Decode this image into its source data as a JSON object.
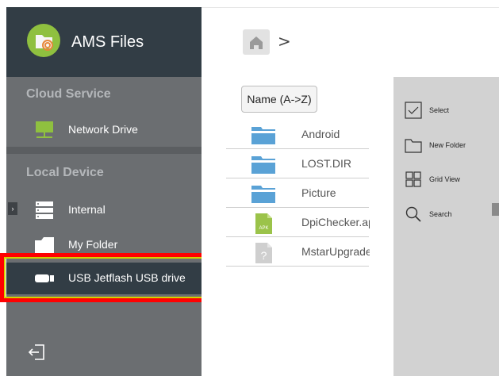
{
  "app": {
    "title": "AMS Files"
  },
  "sidebar": {
    "cloud_section": "Cloud Service",
    "cloud_items": [
      {
        "label": "Network Drive",
        "icon": "network-drive-icon"
      }
    ],
    "local_section": "Local Device",
    "local_items": [
      {
        "label": "Internal",
        "icon": "storage-icon"
      },
      {
        "label": "My Folder",
        "icon": "folder-icon"
      },
      {
        "label": "USB Jetflash USB drive",
        "icon": "usb-icon",
        "selected": true
      }
    ],
    "expander_glyph": "›"
  },
  "breadcrumb": {
    "separator": ">"
  },
  "sort": {
    "label": "Name (A->Z)"
  },
  "files": [
    {
      "name": "Android",
      "type": "folder"
    },
    {
      "name": "LOST.DIR",
      "type": "folder"
    },
    {
      "name": "Picture",
      "type": "folder"
    },
    {
      "name": "DpiChecker.apk",
      "type": "apk",
      "badge": "APK"
    },
    {
      "name": "MstarUpgrade",
      "type": "unknown",
      "badge": "?"
    }
  ],
  "actions": [
    {
      "label": "Select",
      "icon": "checkbox-icon"
    },
    {
      "label": "New Folder",
      "icon": "new-folder-icon"
    },
    {
      "label": "Grid View",
      "icon": "grid-view-icon"
    },
    {
      "label": "Search",
      "icon": "search-icon"
    }
  ],
  "colors": {
    "header": "#323d45",
    "sidebar": "#6b6e71",
    "accent_green": "#8fc03f",
    "folder_blue": "#5aa2d6",
    "highlight": "#ff0000"
  }
}
